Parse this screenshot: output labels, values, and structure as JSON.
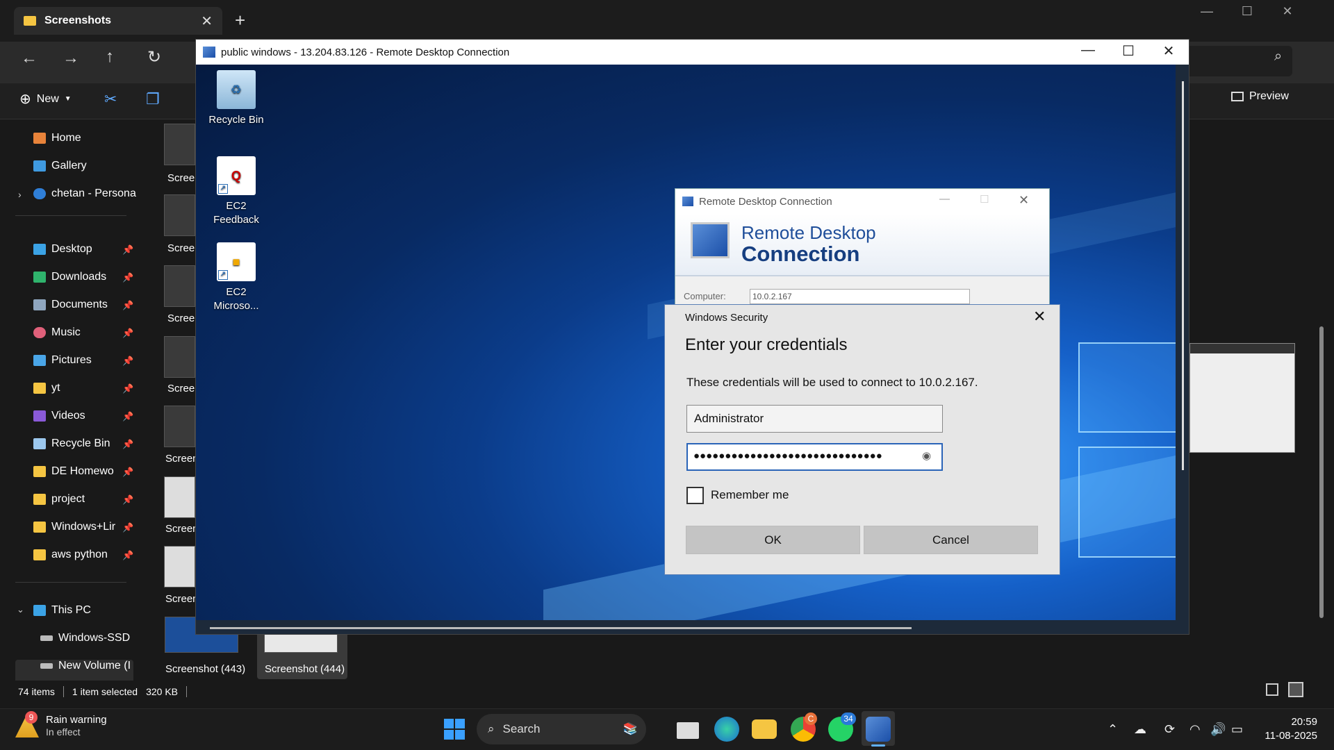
{
  "explorer": {
    "tab_title": "Screenshots",
    "new_label": "New",
    "preview_label": "Preview",
    "sidebar": {
      "home": "Home",
      "gallery": "Gallery",
      "onedrive": "chetan - Persona",
      "pinned": [
        "Desktop",
        "Downloads",
        "Documents",
        "Music",
        "Pictures",
        "yt",
        "Videos",
        "Recycle Bin",
        "DE Homewo",
        "project",
        "Windows+Lir",
        "aws python"
      ],
      "this_pc": "This PC",
      "drives": [
        "Windows-SSD",
        "New Volume (I"
      ]
    },
    "thumb_labels": [
      "Screer",
      "Screer",
      "Screer",
      "Screer",
      "Screen",
      "Screen",
      "Screen"
    ],
    "bottom_thumbs": [
      "Screenshot (443)",
      "Screenshot (444)"
    ],
    "status": {
      "items": "74 items",
      "selected": "1 item selected",
      "size": "320 KB"
    }
  },
  "rdp": {
    "title": "public windows - 13.204.83.126 - Remote Desktop Connection",
    "desktop_icons": [
      {
        "label1": "Recycle Bin",
        "label2": "",
        "icon": "recycle-bin-icon"
      },
      {
        "label1": "EC2",
        "label2": "Feedback",
        "icon": "ec2-feedback-icon"
      },
      {
        "label1": "EC2",
        "label2": "Microso...",
        "icon": "ec2-microsoft-icon"
      }
    ],
    "rdc_dialog": {
      "title": "Remote Desktop Connection",
      "banner1": "Remote Desktop",
      "banner2": "Connection",
      "computer_label": "Computer:",
      "computer_value": "10.0.2.167"
    }
  },
  "security": {
    "header": "Windows Security",
    "heading": "Enter your credentials",
    "message": "These credentials will be used to connect to 10.0.2.167.",
    "username": "Administrator",
    "password_mask": "●●●●●●●●●●●●●●●●●●●●●●●●●●●●●●",
    "remember": "Remember me",
    "remember_checked": false,
    "ok": "OK",
    "cancel": "Cancel"
  },
  "taskbar": {
    "weather_title": "Rain warning",
    "weather_sub": "In effect",
    "weather_badge": "9",
    "search": "Search",
    "chrome_badge": "C",
    "whatsapp_badge": "34",
    "time": "20:59",
    "date": "11-08-2025"
  }
}
